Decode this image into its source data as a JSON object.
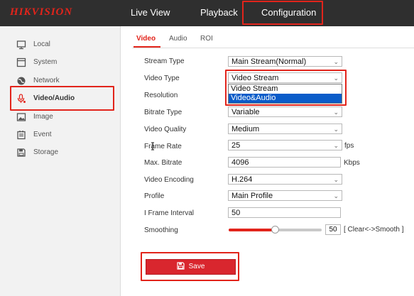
{
  "header": {
    "logo": "HIKVISION",
    "nav": [
      {
        "label": "Live View"
      },
      {
        "label": "Playback"
      },
      {
        "label": "Configuration",
        "active": true
      }
    ]
  },
  "sidebar": {
    "items": [
      {
        "label": "Local",
        "icon": "monitor-icon"
      },
      {
        "label": "System",
        "icon": "window-icon"
      },
      {
        "label": "Network",
        "icon": "globe-icon"
      },
      {
        "label": "Video/Audio",
        "icon": "microphone-icon",
        "active": true
      },
      {
        "label": "Image",
        "icon": "image-icon"
      },
      {
        "label": "Event",
        "icon": "calendar-icon"
      },
      {
        "label": "Storage",
        "icon": "floppy-disk-icon"
      }
    ]
  },
  "tabs": [
    {
      "label": "Video",
      "active": true
    },
    {
      "label": "Audio"
    },
    {
      "label": "ROI"
    }
  ],
  "form": {
    "stream_type": {
      "label": "Stream Type",
      "value": "Main Stream(Normal)"
    },
    "video_type": {
      "label": "Video Type",
      "value": "Video Stream",
      "options": [
        "Video Stream",
        "Video&Audio"
      ],
      "highlighted": "Video&Audio"
    },
    "resolution": {
      "label": "Resolution"
    },
    "bitrate_type": {
      "label": "Bitrate Type",
      "value": "Variable"
    },
    "video_quality": {
      "label": "Video Quality",
      "value": "Medium"
    },
    "frame_rate": {
      "label": "Frame Rate",
      "value": "25",
      "unit": "fps"
    },
    "max_bitrate": {
      "label": "Max. Bitrate",
      "value": "4096",
      "unit": "Kbps"
    },
    "video_encoding": {
      "label": "Video Encoding",
      "value": "H.264"
    },
    "profile": {
      "label": "Profile",
      "value": "Main Profile"
    },
    "i_frame_interval": {
      "label": "I Frame Interval",
      "value": "50"
    },
    "smoothing": {
      "label": "Smoothing",
      "value": "50",
      "level": 0.5,
      "hint": "[ Clear<->Smooth ]"
    }
  },
  "save_button": {
    "label": "Save",
    "icon": "save-icon"
  },
  "colors": {
    "accent": "#e2241b",
    "topbar": "#2f2f2f",
    "selection": "#0a5cc9"
  }
}
